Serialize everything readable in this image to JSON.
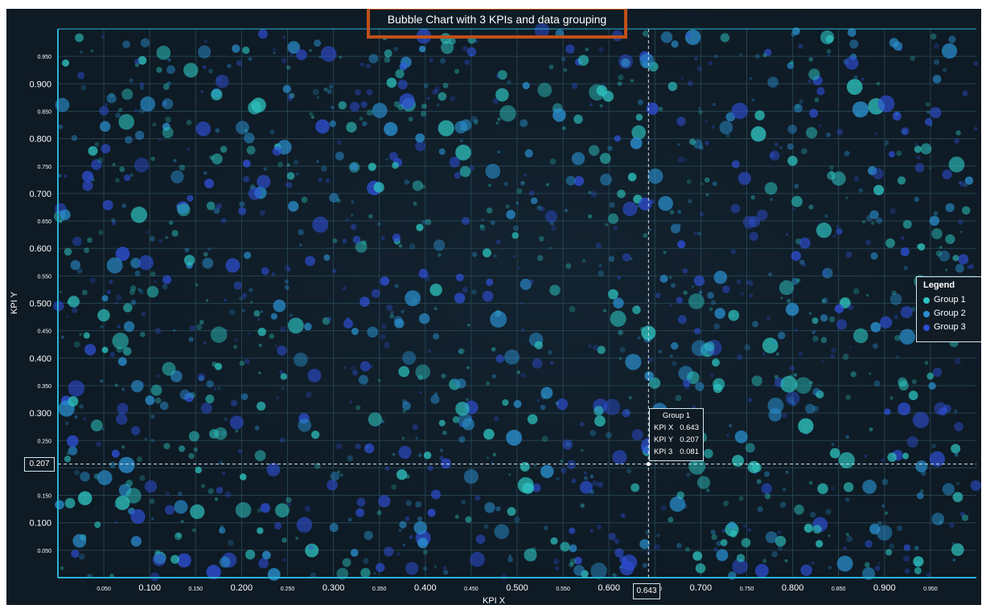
{
  "chart_data": {
    "type": "scatter",
    "title": "Bubble Chart with 3 KPIs and data grouping",
    "xlabel": "KPI X",
    "ylabel": "KPI Y",
    "xlim": [
      0.0,
      1.0
    ],
    "ylim": [
      0.0,
      1.0
    ],
    "grid": true,
    "legend": {
      "title": "Legend",
      "placement": "right",
      "entries": [
        {
          "name": "Group 1",
          "color": "#2ec4c0"
        },
        {
          "name": "Group 2",
          "color": "#2a8fcf"
        },
        {
          "name": "Group 3",
          "color": "#2f4fd6"
        }
      ]
    },
    "x_ticks_major": [
      "0.100",
      "0.200",
      "0.300",
      "0.400",
      "0.500",
      "0.600",
      "0.700",
      "0.800",
      "0.900"
    ],
    "x_ticks_minor": [
      "0.050",
      "0.150",
      "0.250",
      "0.350",
      "0.450",
      "0.550",
      "0.650",
      "0.750",
      "0.850",
      "0.950"
    ],
    "y_ticks_major": [
      "0.100",
      "0.200",
      "0.300",
      "0.400",
      "0.500",
      "0.600",
      "0.700",
      "0.800",
      "0.900"
    ],
    "y_ticks_minor": [
      "0.050",
      "0.150",
      "0.250",
      "0.350",
      "0.450",
      "0.550",
      "0.650",
      "0.750",
      "0.850",
      "0.950"
    ],
    "series_note_count": 1500,
    "highlight": {
      "group": "Group 1",
      "kpi_x_label": "KPI X",
      "kpi_y_label": "KPI Y",
      "kpi_3_label": "KPI 3",
      "kpi_x": "0.643",
      "kpi_y": "0.207",
      "kpi_3": "0.081",
      "x": 0.643,
      "y": 0.207
    }
  },
  "colors": {
    "background": "#0e1a24",
    "axis": "#2ab3d6",
    "grid": "#24424f",
    "crosshair": "#d8e6ea",
    "title_border": "#c0501a"
  }
}
